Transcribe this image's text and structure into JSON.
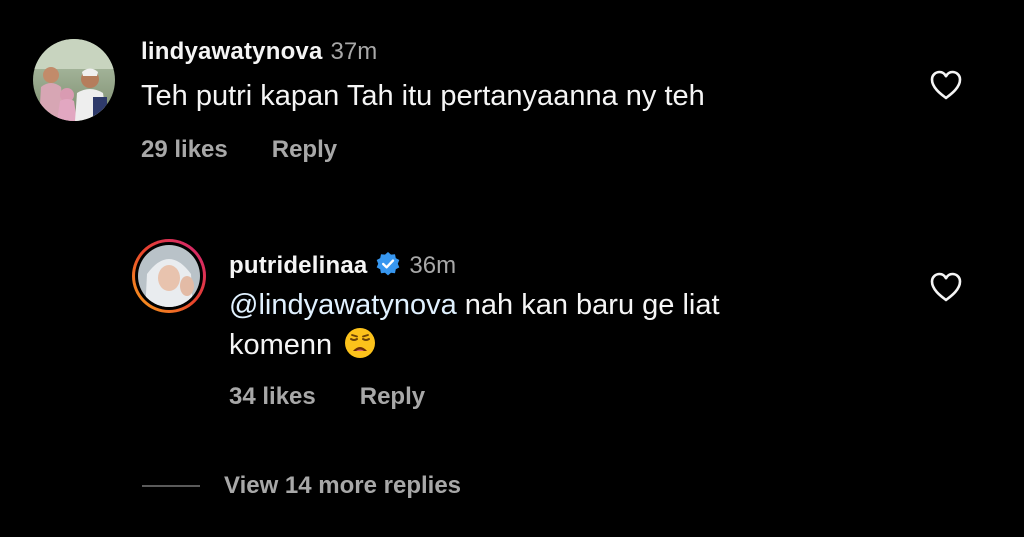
{
  "comments": [
    {
      "username": "lindyawatynova",
      "time": "37m",
      "text": "Teh putri kapan Tah itu pertanyaanna ny teh",
      "likes": "29 likes",
      "reply_label": "Reply"
    }
  ],
  "replies": [
    {
      "username": "putridelinaa",
      "verified": true,
      "time": "36m",
      "mention": "@lindyawatynova",
      "text_line1": " nah kan baru ge liat",
      "text_line2": "komenn",
      "emoji": "weary-face",
      "likes": "34 likes",
      "reply_label": "Reply"
    }
  ],
  "view_more_label": "View 14 more replies",
  "colors": {
    "background": "#000000",
    "primary_text": "#f5f5f5",
    "secondary_text": "#a8a8a8",
    "verified_blue": "#3797f0",
    "story_ring_start": "#f9a51a",
    "story_ring_end": "#d1207c"
  }
}
